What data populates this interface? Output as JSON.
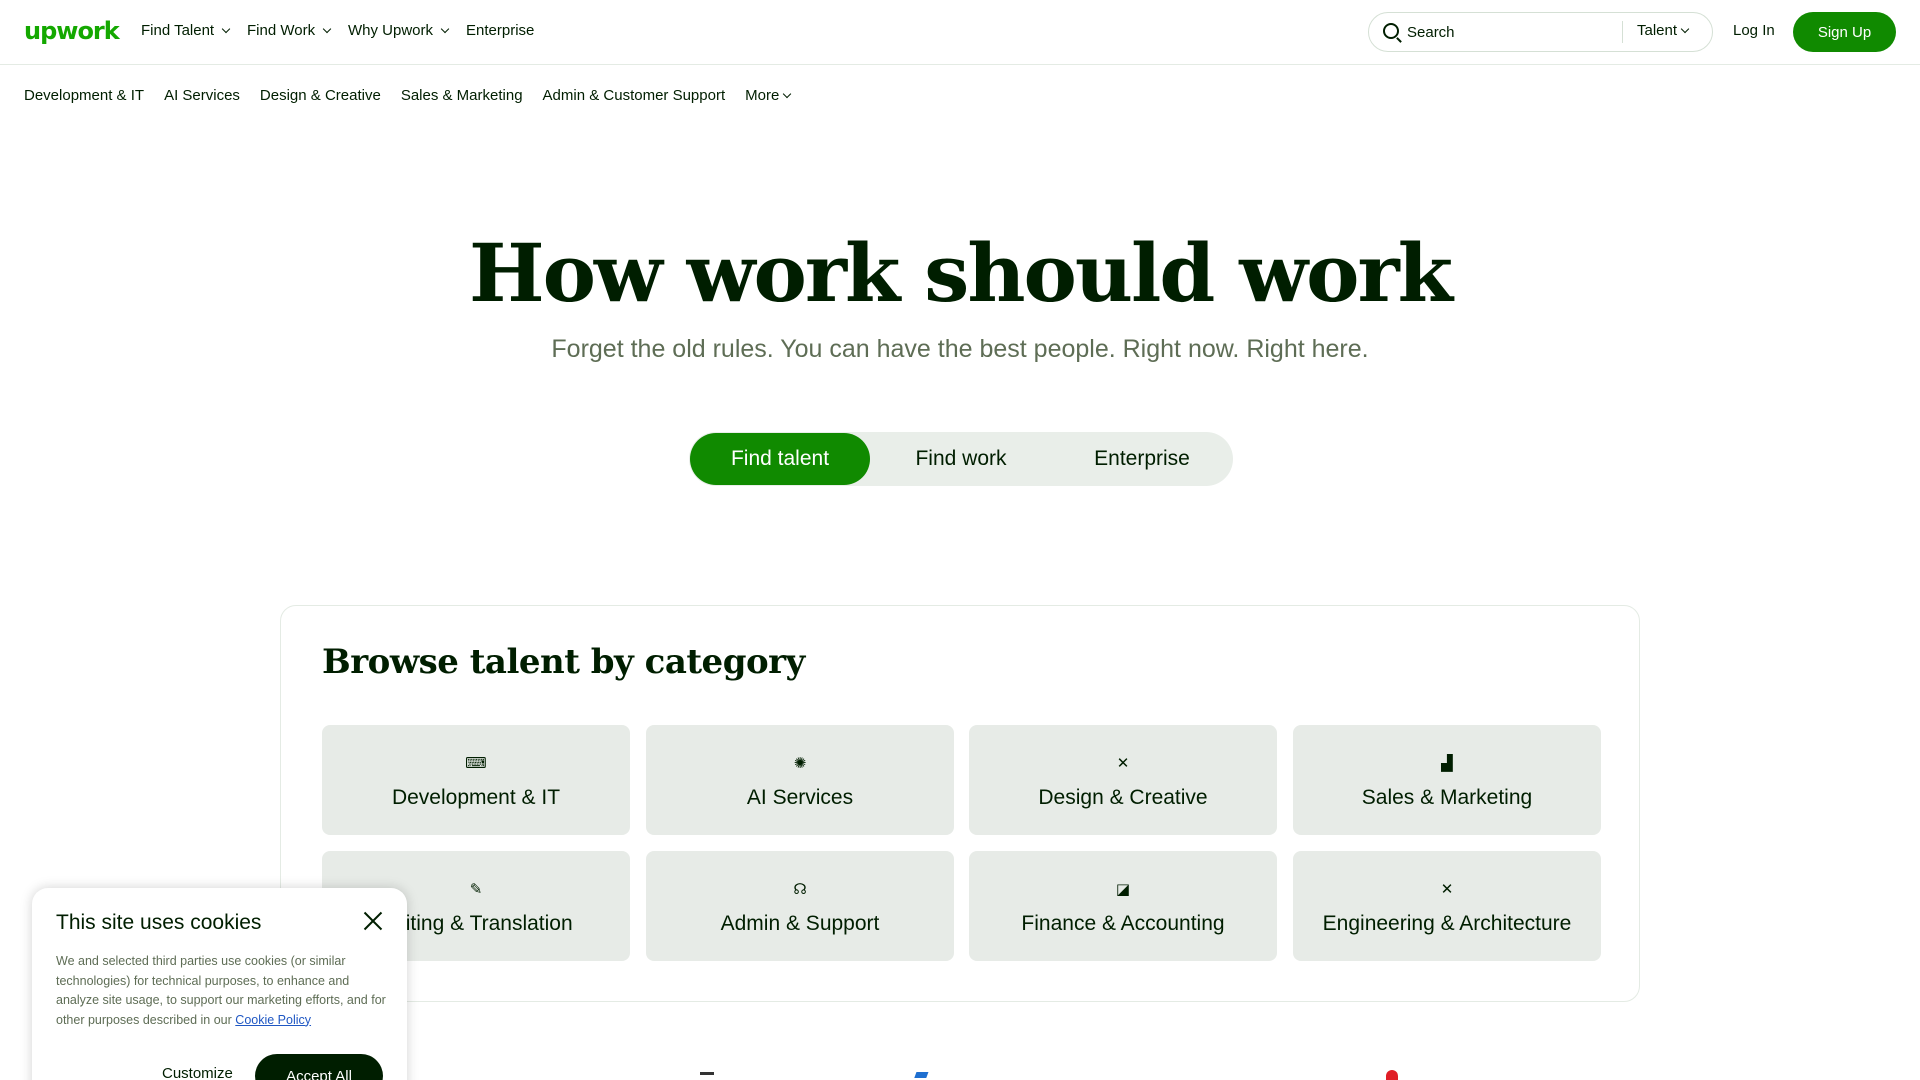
{
  "brand": {
    "logo_text": "upwork",
    "primary_color": "#108a00",
    "logo_color": "#14a800",
    "dark_color": "#001e00"
  },
  "topnav": {
    "items": [
      {
        "label": "Find Talent",
        "has_dropdown": true
      },
      {
        "label": "Find Work",
        "has_dropdown": true
      },
      {
        "label": "Why Upwork",
        "has_dropdown": true
      },
      {
        "label": "Enterprise",
        "has_dropdown": false
      }
    ],
    "search": {
      "placeholder": "Search",
      "scope": "Talent"
    },
    "login": "Log In",
    "signup": "Sign Up"
  },
  "category_bar": {
    "items": [
      "Development & IT",
      "AI Services",
      "Design & Creative",
      "Sales & Marketing",
      "Admin & Customer Support"
    ],
    "more": "More"
  },
  "hero": {
    "title": "How work should work",
    "subtitle": "Forget the old rules. You can have the best people. Right now. Right here.",
    "toggle": [
      "Find talent",
      "Find work",
      "Enterprise"
    ],
    "active_toggle": "Find talent"
  },
  "browse": {
    "title": "Browse talent by category",
    "categories": [
      {
        "label": "Development & IT",
        "icon": "code-window-icon",
        "glyph": "⌨"
      },
      {
        "label": "AI Services",
        "icon": "brain-icon",
        "glyph": "✺"
      },
      {
        "label": "Design & Creative",
        "icon": "design-tools-icon",
        "glyph": "✕"
      },
      {
        "label": "Sales & Marketing",
        "icon": "growth-chart-icon",
        "glyph": "▟"
      },
      {
        "label": "Writing & Translation",
        "icon": "pen-icon",
        "glyph": "✎"
      },
      {
        "label": "Admin & Support",
        "icon": "headset-icon",
        "glyph": "☊"
      },
      {
        "label": "Finance & Accounting",
        "icon": "line-chart-icon",
        "glyph": "◪"
      },
      {
        "label": "Engineering & Architecture",
        "icon": "ruler-pencil-icon",
        "glyph": "✕"
      }
    ]
  },
  "cookie": {
    "title": "This site uses cookies",
    "body": "We and selected third parties use cookies (or similar technologies) for technical purposes, to enhance and analyze site usage, to support our marketing efforts, and for other purposes described in our",
    "link": "Cookie Policy",
    "customize": "Customize",
    "accept": "Accept All"
  }
}
